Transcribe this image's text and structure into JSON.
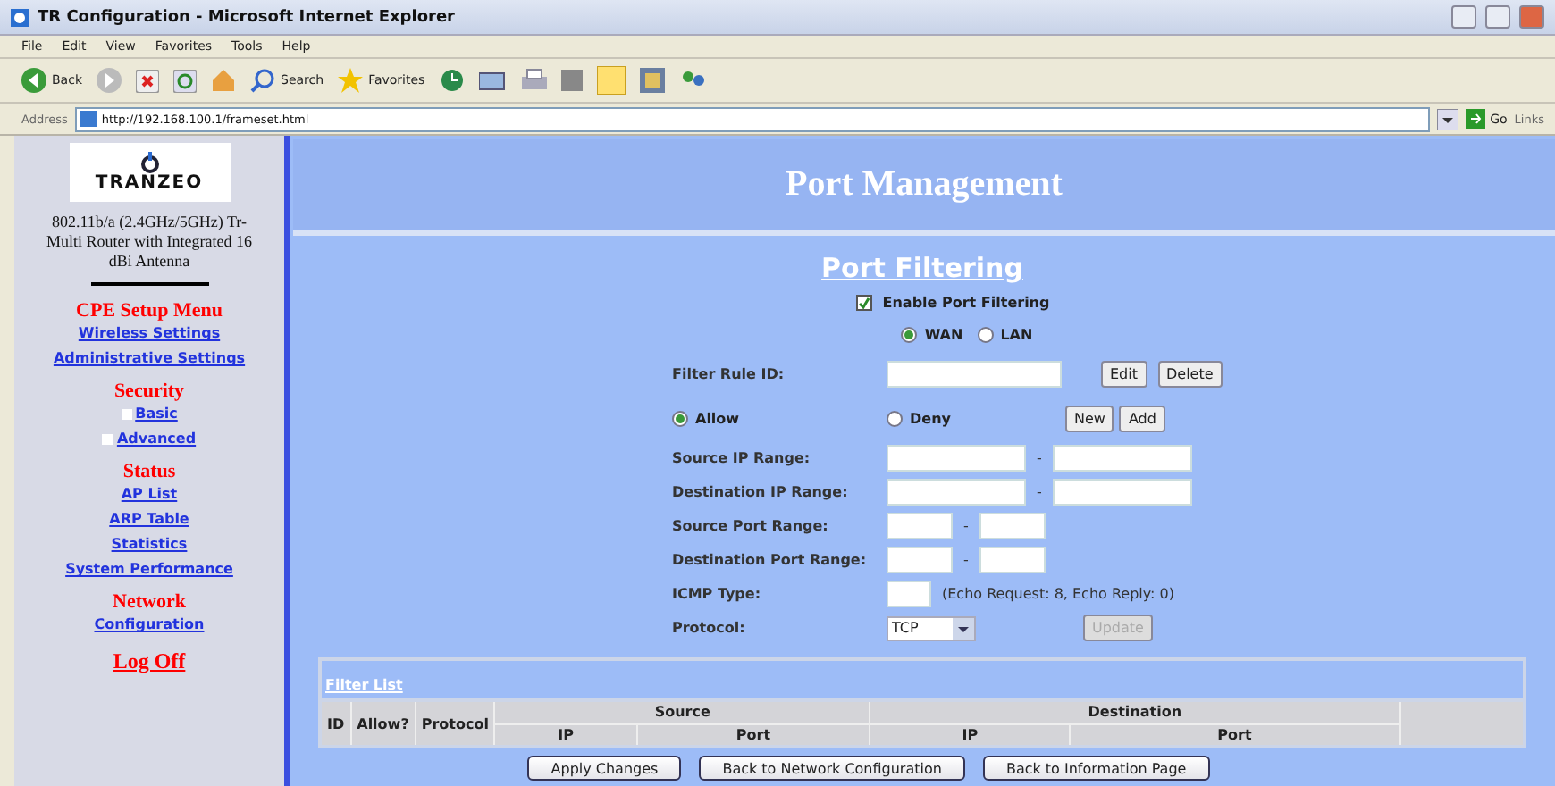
{
  "window": {
    "title": "TR Configuration - Microsoft Internet Explorer"
  },
  "menu": [
    "File",
    "Edit",
    "View",
    "Favorites",
    "Tools",
    "Help"
  ],
  "toolbar": {
    "back": "Back",
    "search": "Search",
    "favorites": "Favorites"
  },
  "address": {
    "label": "Address",
    "url": "http://192.168.100.1/frameset.html",
    "go": "Go",
    "links": "Links"
  },
  "sidebar": {
    "logo": "TRANZEO",
    "description": "802.11b/a (2.4GHz/5GHz) Tr-Multi Router with Integrated 16 dBi Antenna",
    "sections": [
      {
        "title": "CPE Setup Menu",
        "items": [
          {
            "label": "Wireless Settings",
            "kind": "link"
          },
          {
            "label": "Administrative Settings",
            "kind": "link"
          }
        ]
      },
      {
        "title": "Security",
        "items": [
          {
            "label": "Basic",
            "kind": "bullet"
          },
          {
            "label": "Advanced",
            "kind": "bullet"
          }
        ]
      },
      {
        "title": "Status",
        "items": [
          {
            "label": "AP List",
            "kind": "link"
          },
          {
            "label": "ARP Table",
            "kind": "link"
          },
          {
            "label": "Statistics",
            "kind": "link"
          },
          {
            "label": "System Performance",
            "kind": "link"
          }
        ]
      },
      {
        "title": "Network",
        "items": [
          {
            "label": "Configuration",
            "kind": "link"
          }
        ]
      }
    ],
    "logoff": "Log Off"
  },
  "main": {
    "heading": "Port Management",
    "subheading": "Port Filtering",
    "enable": {
      "label": "Enable Port Filtering",
      "checked": true
    },
    "interfaces": [
      {
        "label": "WAN",
        "selected": true
      },
      {
        "label": "LAN",
        "selected": false
      }
    ],
    "rows": [
      {
        "kind": "field",
        "label": "Filter Rule ID:",
        "buttons": [
          "Edit",
          "Delete"
        ]
      },
      {
        "kind": "action",
        "options": [
          {
            "label": "Allow",
            "selected": true
          },
          {
            "label": "Deny",
            "selected": false
          }
        ],
        "buttons": [
          "New",
          "Add"
        ]
      },
      {
        "kind": "ip_range",
        "label": "Source IP Range:",
        "separator": "-"
      },
      {
        "kind": "ip_range",
        "label": "Destination IP Range:",
        "separator": "-"
      },
      {
        "kind": "port_range",
        "label": "Source Port Range:",
        "separator": "-"
      },
      {
        "kind": "port_range",
        "label": "Destination Port Range:",
        "separator": "-"
      },
      {
        "kind": "hint",
        "label": "ICMP Type:",
        "hint": "(Echo Request: 8, Echo Reply: 0)"
      },
      {
        "kind": "select",
        "label": "Protocol:",
        "value": "TCP",
        "button": {
          "label": "Update",
          "disabled": true
        }
      }
    ],
    "filter_list": {
      "caption": "Filter List",
      "columns": [
        "ID",
        "Allow?",
        "Protocol"
      ],
      "groups": [
        {
          "label": "Source",
          "sub": [
            "IP",
            "Port"
          ]
        },
        {
          "label": "Destination",
          "sub": [
            "IP",
            "Port"
          ]
        }
      ]
    },
    "buttons": [
      "Apply Changes",
      "Back to Network Configuration",
      "Back to Information Page"
    ]
  }
}
